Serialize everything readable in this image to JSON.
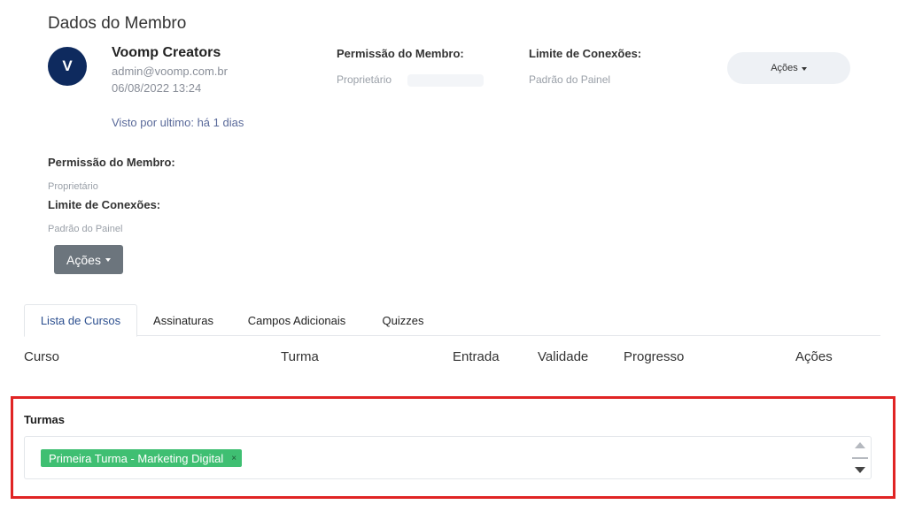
{
  "page": {
    "title": "Dados do Membro"
  },
  "member": {
    "avatar_letter": "V",
    "name": "Voomp Creators",
    "email": "admin@voomp.com.br",
    "created": "06/08/2022 13:24",
    "last_seen": "Visto por ultimo: há 1 dias"
  },
  "header_info": {
    "permission_label": "Permissão do Membro:",
    "permission_value": "Proprietário",
    "connections_label": "Limite de Conexões:",
    "connections_value": "Padrão do Painel",
    "actions_label": "Ações"
  },
  "mobile_info": {
    "permission_label": "Permissão do Membro:",
    "permission_value": "Proprietário",
    "connections_label": "Limite de Conexões:",
    "connections_value": "Padrão do Painel",
    "actions_label": "Ações"
  },
  "tabs": [
    {
      "label": "Lista de Cursos",
      "active": true
    },
    {
      "label": "Assinaturas",
      "active": false
    },
    {
      "label": "Campos Adicionais",
      "active": false
    },
    {
      "label": "Quizzes",
      "active": false
    }
  ],
  "table": {
    "columns": [
      "Curso",
      "Turma",
      "Entrada",
      "Validade",
      "Progresso",
      "Ações"
    ]
  },
  "turmas": {
    "label": "Turmas",
    "selected": [
      {
        "label": "Primeira Turma - Marketing Digital",
        "remove": "×"
      }
    ]
  },
  "colors": {
    "avatar_bg": "#0e2a5e",
    "chip_bg": "#3fbf72",
    "actions_btn_bg": "#6c757d",
    "highlight_frame": "#e02424",
    "active_tab_text": "#2c4f8f"
  }
}
